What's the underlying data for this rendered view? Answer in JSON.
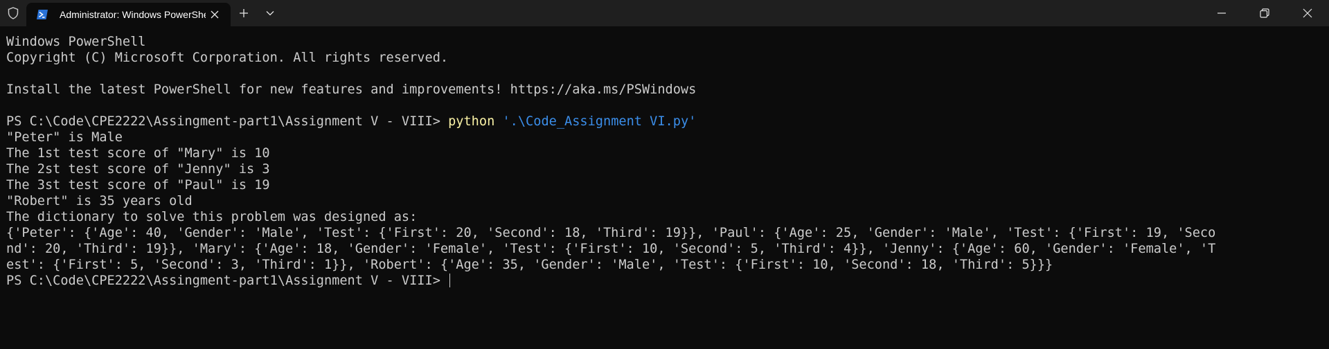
{
  "window": {
    "tab_title": "Administrator: Windows PowerShell",
    "icons": {
      "shield": "shield-icon",
      "tab": "powershell-icon",
      "close_tab": "close-icon",
      "new_tab": "plus-icon",
      "dropdown": "chevron-down-icon",
      "minimize": "minimize-icon",
      "maximize": "restore-icon",
      "close_window": "close-icon"
    }
  },
  "terminal": {
    "header1": "Windows PowerShell",
    "header2": "Copyright (C) Microsoft Corporation. All rights reserved.",
    "install": "Install the latest PowerShell for new features and improvements! https://aka.ms/PSWindows",
    "prompt1": "PS C:\\Code\\CPE2222\\Assingment-part1\\Assignment V - VIII> ",
    "cmd": "python",
    "arg": "'.\\Code_Assignment VI.py'",
    "out1": "\"Peter\" is Male",
    "out2": "The 1st test score of \"Mary\" is 10",
    "out3": "The 2st test score of \"Jenny\" is 3",
    "out4": "The 3st test score of \"Paul\" is 19",
    "out5": "\"Robert\" is 35 years old",
    "out6": "The dictionary to solve this problem was designed as:",
    "dict1": "{'Peter': {'Age': 40, 'Gender': 'Male', 'Test': {'First': 20, 'Second': 18, 'Third': 19}}, 'Paul': {'Age': 25, 'Gender': 'Male', 'Test': {'First': 19, 'Seco",
    "dict2": "nd': 20, 'Third': 19}}, 'Mary': {'Age': 18, 'Gender': 'Female', 'Test': {'First': 10, 'Second': 5, 'Third': 4}}, 'Jenny': {'Age': 60, 'Gender': 'Female', 'T",
    "dict3": "est': {'First': 5, 'Second': 3, 'Third': 1}}, 'Robert': {'Age': 35, 'Gender': 'Male', 'Test': {'First': 10, 'Second': 18, 'Third': 5}}}",
    "prompt2": "PS C:\\Code\\CPE2222\\Assingment-part1\\Assignment V - VIII> "
  },
  "colors": {
    "background": "#0c0c0c",
    "titlebar": "#1f1f1f",
    "text": "#cccccc",
    "command": "#f9f1a5",
    "string_arg": "#3b8eea"
  }
}
